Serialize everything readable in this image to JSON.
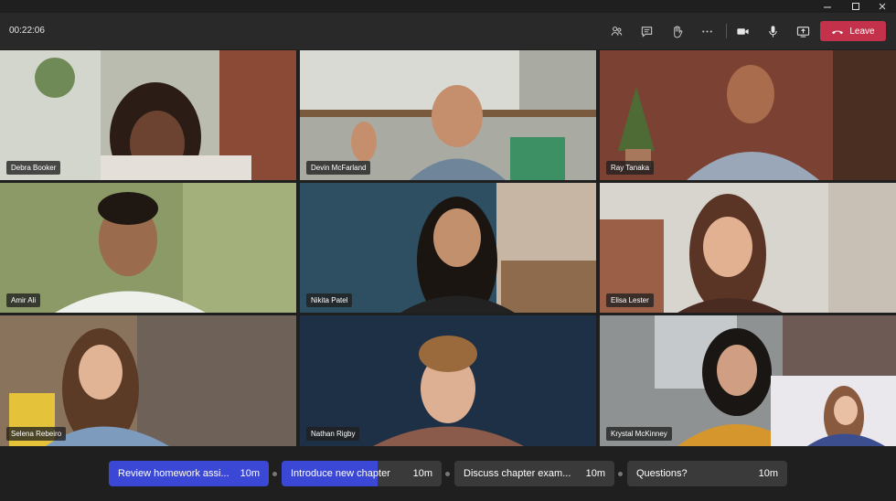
{
  "window": {
    "minimize_icon": "minimize-icon",
    "maximize_icon": "maximize-icon",
    "close_icon": "close-icon"
  },
  "toolbar": {
    "timer": "00:22:06",
    "icons": [
      "people-icon",
      "chat-icon",
      "raise-hand-icon",
      "more-icon",
      "camera-icon",
      "microphone-icon",
      "share-screen-icon"
    ],
    "leave_label": "Leave",
    "leave_color": "#c4314b"
  },
  "participants": [
    {
      "name": "Debra Booker"
    },
    {
      "name": "Devin McFarland"
    },
    {
      "name": "Ray Tanaka",
      "speaking": true
    },
    {
      "name": "Amir Ali"
    },
    {
      "name": "Nikita Patel"
    },
    {
      "name": "Elisa Lester"
    },
    {
      "name": "Selena Rebeiro"
    },
    {
      "name": "Nathan Rigby"
    },
    {
      "name": "Krystal McKinney"
    }
  ],
  "agenda": [
    {
      "label": "Review homework assi...",
      "duration": "10m",
      "status": "done"
    },
    {
      "label": "Introduce new chapter",
      "duration": "10m",
      "status": "current",
      "progress": 0.6
    },
    {
      "label": "Discuss chapter exam...",
      "duration": "10m",
      "status": "upcoming"
    },
    {
      "label": "Questions?",
      "duration": "10m",
      "status": "upcoming"
    }
  ],
  "colors": {
    "accent": "#3b48d6",
    "speaking_outline": "#7f85f5",
    "toolbar_bg": "#292929"
  }
}
